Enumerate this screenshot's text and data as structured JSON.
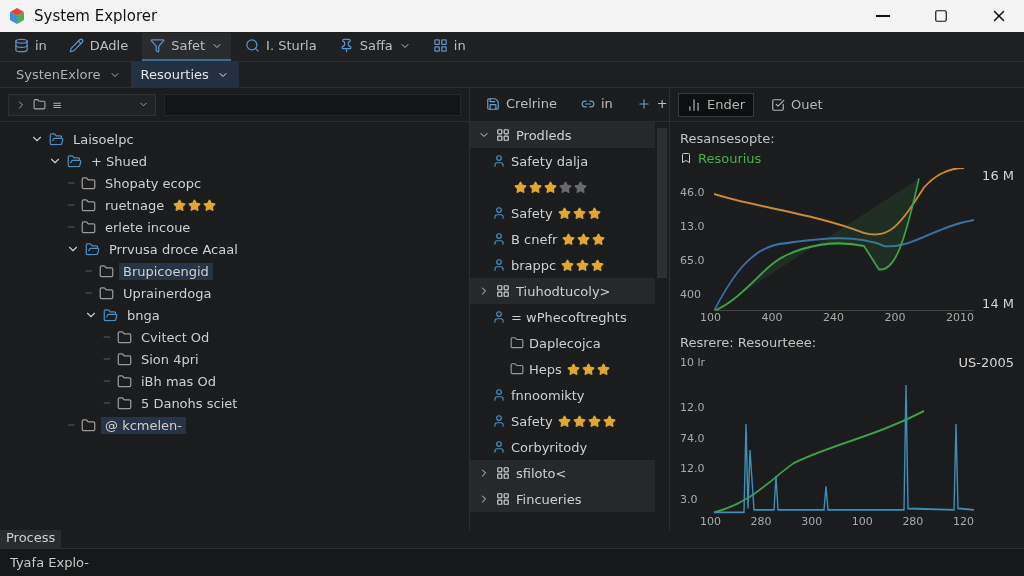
{
  "window": {
    "title": "System Explorer"
  },
  "toolbar": [
    {
      "label": "in",
      "dropdown": false,
      "selected": false
    },
    {
      "label": "DAdle",
      "dropdown": false,
      "selected": false
    },
    {
      "label": "Safet",
      "dropdown": true,
      "selected": true
    },
    {
      "label": "I. Sturla",
      "dropdown": false,
      "selected": false
    },
    {
      "label": "Saffa",
      "dropdown": true,
      "selected": false
    },
    {
      "label": "in",
      "dropdown": false,
      "selected": false
    }
  ],
  "tabs": [
    {
      "label": "SystenExlore",
      "selected": false
    },
    {
      "label": "Resourties",
      "selected": true
    }
  ],
  "left_panel": {
    "filter_icon_text": "≡",
    "tree": [
      {
        "label": "Laisoelpc",
        "expanded": true,
        "selected": false,
        "children": [
          {
            "label": "+ Shued",
            "expanded": true,
            "selected": false,
            "children": [
              {
                "label": "Shopaty ecopc",
                "selected": false
              },
              {
                "label": "ruetnage",
                "selected": false,
                "stars": 3
              },
              {
                "label": "erlete incoue",
                "selected": false
              },
              {
                "label": "Prrvusa droce  Acaal",
                "expanded": true,
                "selected": false,
                "children": [
                  {
                    "label": "Brupicoengid",
                    "selected": true
                  },
                  {
                    "label": "Uprainerdoga",
                    "selected": false
                  },
                  {
                    "label": "bnga",
                    "expanded": true,
                    "selected": false,
                    "children": [
                      {
                        "label": "Cvitect Od",
                        "selected": false
                      },
                      {
                        "label": "Sion 4pri",
                        "selected": false
                      },
                      {
                        "label": "iBh mas Od",
                        "selected": false
                      },
                      {
                        "label": "5 Danohs sciet",
                        "selected": false
                      }
                    ]
                  }
                ]
              },
              {
                "label": "@ kcmelen-",
                "selected": true
              }
            ]
          }
        ]
      }
    ]
  },
  "middle_panel": {
    "toolbar": [
      "Crelrine",
      "in",
      "+"
    ],
    "groups": [
      {
        "label": "Prodleds",
        "expanded": true,
        "items": [
          {
            "kind": "item",
            "label": "Safety dalja"
          },
          {
            "kind": "rating",
            "stars": 3
          },
          {
            "kind": "item",
            "label": "Safety",
            "stars": 3
          },
          {
            "kind": "item",
            "label": "B cnefr",
            "stars": 3
          },
          {
            "kind": "item",
            "label": "brappc",
            "stars": 3
          }
        ]
      },
      {
        "label": "Tiuhodtucoly>",
        "expanded": false,
        "items": [
          {
            "kind": "item",
            "label": "= wPhecoftreghts"
          },
          {
            "kind": "sub",
            "label": "Daplecojca"
          },
          {
            "kind": "sub",
            "label": "Heps",
            "stars": 3
          },
          {
            "kind": "item",
            "label": "fnnoomikty"
          },
          {
            "kind": "item",
            "label": "Safety",
            "stars": 4
          },
          {
            "kind": "item",
            "label": "Corbyritody"
          }
        ]
      },
      {
        "label": "sfiloto<",
        "expanded": false
      },
      {
        "label": "Fincueries",
        "expanded": false
      }
    ]
  },
  "right_panel": {
    "toolbar": [
      {
        "label": "Ender",
        "selected": true
      },
      {
        "label": "Ouet",
        "selected": false
      }
    ],
    "charts": [
      {
        "title": "Resansesopte:",
        "legend": "Resourius",
        "right_label_top": "16 M",
        "right_label_bottom": "14 M",
        "yticks": [
          "46.0",
          "13.0",
          "65.0",
          "400"
        ],
        "xticks": [
          "100",
          "400",
          "240",
          "200",
          "2010"
        ]
      },
      {
        "title": "Resrere: Resourteee:",
        "left_label": "10 lr",
        "right_label_top": "US-2005",
        "yticks": [
          "12.0",
          "74.0",
          "12.0",
          "3.0"
        ],
        "xticks": [
          "100",
          "280",
          "300",
          "100",
          "280",
          "120"
        ]
      }
    ]
  },
  "bottom_tab": "Process",
  "status_bar": "Tyafa Explo-"
}
